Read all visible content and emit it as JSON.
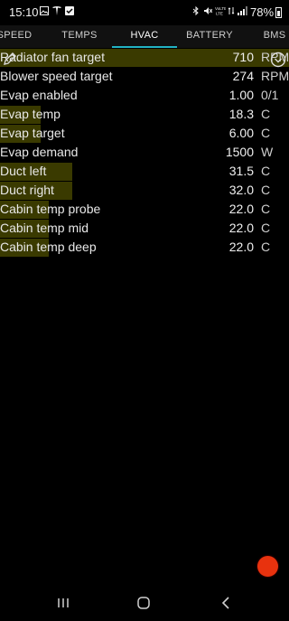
{
  "status_bar": {
    "time": "15:10",
    "battery_percent": "78%",
    "icons": [
      "gallery-icon",
      "tesla-icon",
      "check-icon",
      "bluetooth-icon",
      "mute-icon",
      "volte-icon",
      "lte-icon",
      "signal-icon",
      "battery-icon"
    ]
  },
  "tabs": [
    {
      "label": "SPEED"
    },
    {
      "label": "TEMPS"
    },
    {
      "label": "HVAC"
    },
    {
      "label": "BATTERY"
    },
    {
      "label": "BMS"
    }
  ],
  "active_tab": "HVAC",
  "rows": [
    {
      "label": "Radiator fan target",
      "value": "710",
      "unit": "RPM",
      "level": 1.0
    },
    {
      "label": "Blower speed target",
      "value": "274",
      "unit": "RPM",
      "level": 0
    },
    {
      "label": "Evap enabled",
      "value": "1.00",
      "unit": "0/1",
      "level": 0
    },
    {
      "label": "Evap temp",
      "value": "18.3",
      "unit": "C",
      "level": 0.14
    },
    {
      "label": "Evap target",
      "value": "6.00",
      "unit": "C",
      "level": 0.14
    },
    {
      "label": "Evap demand",
      "value": "1500",
      "unit": "W",
      "level": 0
    },
    {
      "label": "Duct left",
      "value": "31.5",
      "unit": "C",
      "level": 0.25
    },
    {
      "label": "Duct right",
      "value": "32.0",
      "unit": "C",
      "level": 0.25
    },
    {
      "label": "Cabin temp probe",
      "value": "22.0",
      "unit": "C",
      "level": 0.17
    },
    {
      "label": "Cabin temp mid",
      "value": "22.0",
      "unit": "C",
      "level": 0.17
    },
    {
      "label": "Cabin temp deep",
      "value": "22.0",
      "unit": "C",
      "level": 0.17
    }
  ],
  "colors": {
    "background": "#000000",
    "tab_indicator": "#22b3c2",
    "level_bar": "#3a3a00",
    "fab": "#e8320e"
  }
}
